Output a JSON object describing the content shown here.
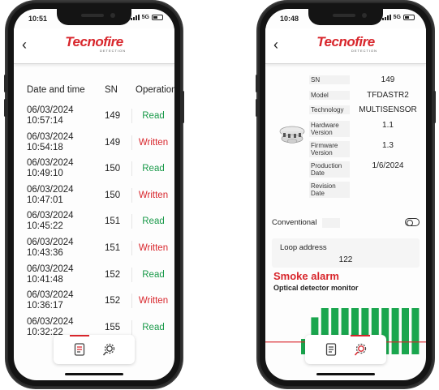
{
  "colors": {
    "brand_red": "#d8262c",
    "read_green": "#1a9a4a",
    "bar_green": "#1aa64e"
  },
  "left": {
    "status": {
      "time": "10:51",
      "network": "5G"
    },
    "header": {
      "back_icon": "back-chevron-icon",
      "logo": "Tecnofire",
      "logo_sub": "DETECTION"
    },
    "table": {
      "columns": [
        "Date and time",
        "SN",
        "Operation"
      ],
      "rows": [
        {
          "date": "06/03/2024",
          "time": "10:57:14",
          "sn": "149",
          "op": "Read"
        },
        {
          "date": "06/03/2024",
          "time": "10:54:18",
          "sn": "149",
          "op": "Written"
        },
        {
          "date": "06/03/2024",
          "time": "10:49:10",
          "sn": "150",
          "op": "Read"
        },
        {
          "date": "06/03/2024",
          "time": "10:47:01",
          "sn": "150",
          "op": "Written"
        },
        {
          "date": "06/03/2024",
          "time": "10:45:22",
          "sn": "151",
          "op": "Read"
        },
        {
          "date": "06/03/2024",
          "time": "10:43:36",
          "sn": "151",
          "op": "Written"
        },
        {
          "date": "06/03/2024",
          "time": "10:41:48",
          "sn": "152",
          "op": "Read"
        },
        {
          "date": "06/03/2024",
          "time": "10:36:17",
          "sn": "152",
          "op": "Written"
        },
        {
          "date": "06/03/2024",
          "time": "10:32:22",
          "sn": "155",
          "op": "Read"
        }
      ]
    },
    "tabs": [
      {
        "icon": "document-list-icon",
        "active": true
      },
      {
        "icon": "gear-settings-icon",
        "active": false
      }
    ]
  },
  "right": {
    "status": {
      "time": "10:48",
      "network": "5G"
    },
    "header": {
      "back_icon": "back-chevron-icon",
      "logo": "Tecnofire",
      "logo_sub": "DETECTION"
    },
    "info": [
      {
        "label": "SN",
        "value": "149"
      },
      {
        "label": "Model",
        "value": "TFDASTR2"
      },
      {
        "label": "Technology",
        "value": "MULTISENSOR"
      },
      {
        "label": "Hardware Version",
        "value": "1.1"
      },
      {
        "label": "Firmware Version",
        "value": "1.3"
      },
      {
        "label": "Production Date",
        "value": "1/6/2024"
      },
      {
        "label": "Revision Date",
        "value": ""
      }
    ],
    "conventional_label": "Conventional",
    "conventional_on": false,
    "loop_address_label": "Loop address",
    "loop_address_value": "122",
    "alarm_title": "Smoke alarm",
    "monitor_title": "Optical detector monitor",
    "monitor_levels": [
      0.25,
      0.6,
      0.75,
      0.75,
      0.75,
      0.75,
      0.75,
      0.75,
      0.75,
      0.75,
      0.75,
      0.75
    ],
    "monitor_threshold": 0.2,
    "tabs": [
      {
        "icon": "document-list-icon",
        "active": false
      },
      {
        "icon": "gear-settings-icon",
        "active": true
      }
    ]
  }
}
